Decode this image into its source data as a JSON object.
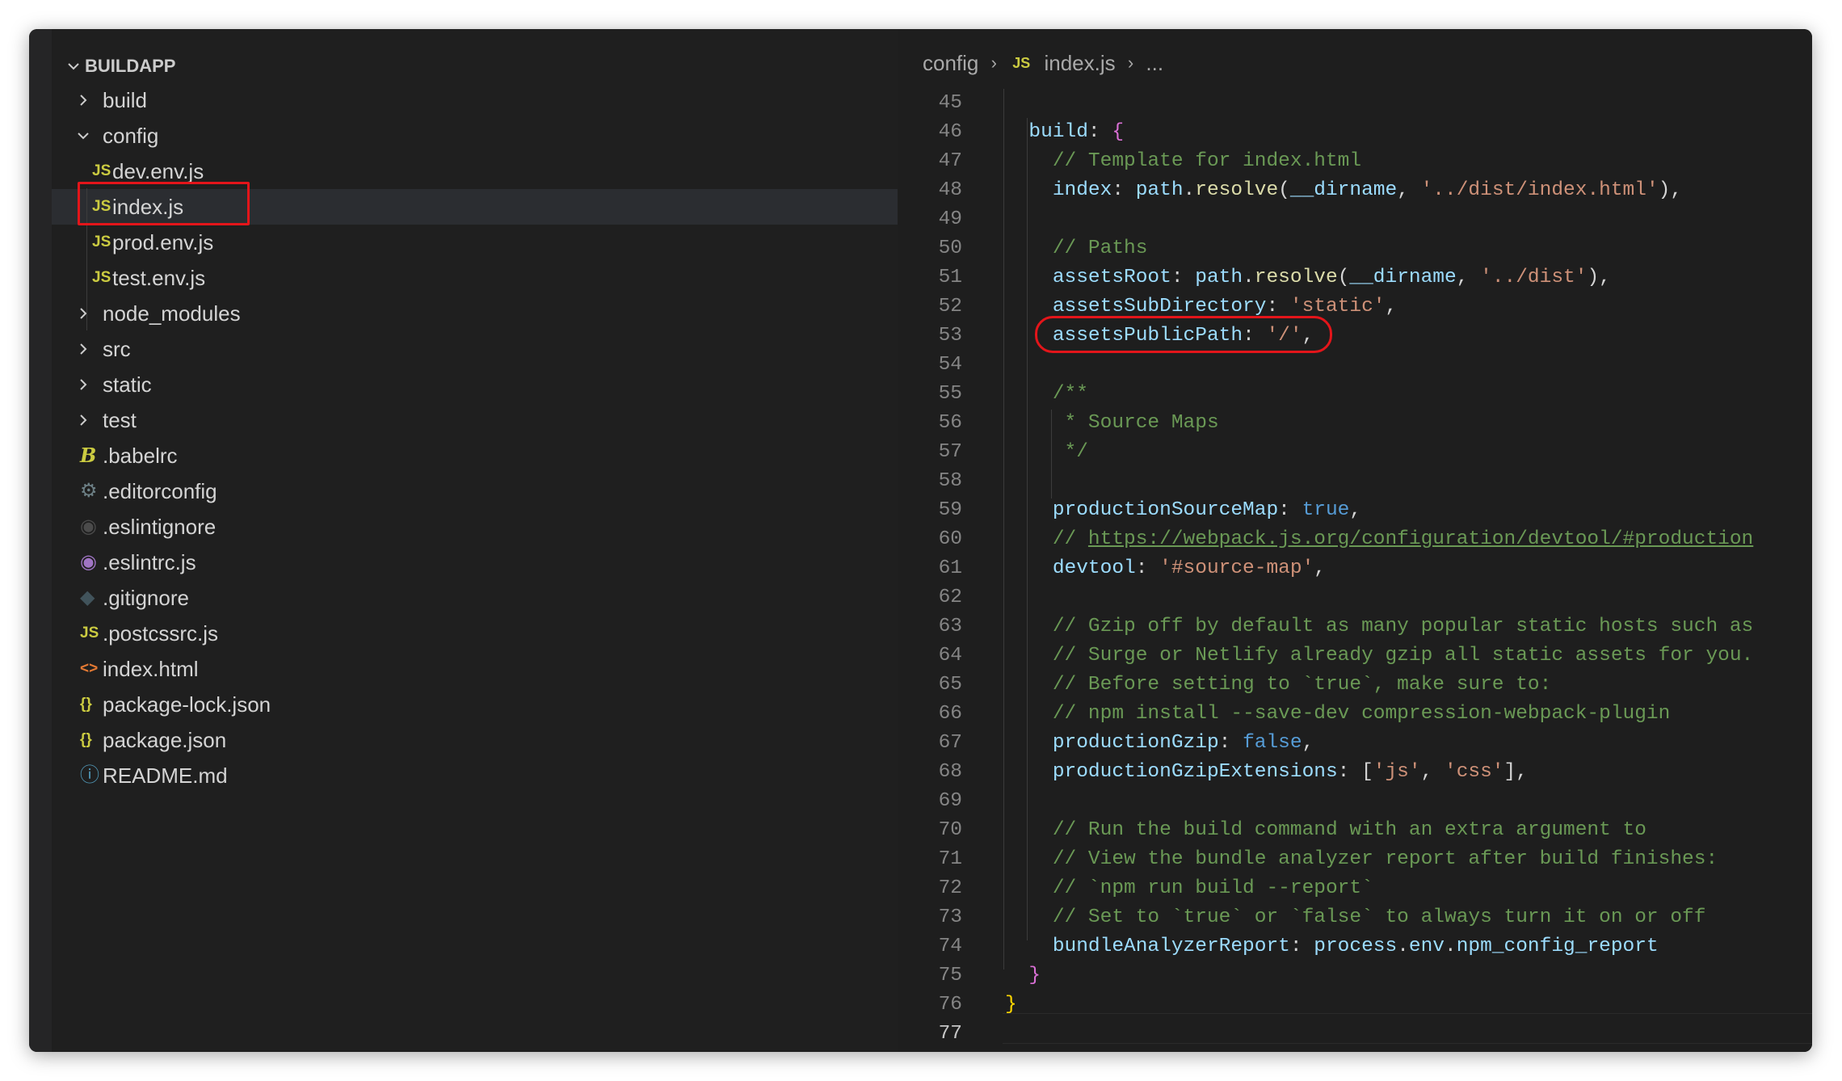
{
  "explorer": {
    "root": "BUILDAPP",
    "items": [
      {
        "label": "build",
        "type": "folder",
        "expanded": false,
        "depth": 1
      },
      {
        "label": "config",
        "type": "folder",
        "expanded": true,
        "depth": 1
      },
      {
        "label": "dev.env.js",
        "type": "js",
        "icon": "JS",
        "depth": 2
      },
      {
        "label": "index.js",
        "type": "js",
        "icon": "JS",
        "depth": 2,
        "selected": true
      },
      {
        "label": "prod.env.js",
        "type": "js",
        "icon": "JS",
        "depth": 2
      },
      {
        "label": "test.env.js",
        "type": "js",
        "icon": "JS",
        "depth": 2
      },
      {
        "label": "node_modules",
        "type": "folder",
        "expanded": false,
        "depth": 1
      },
      {
        "label": "src",
        "type": "folder",
        "expanded": false,
        "depth": 1
      },
      {
        "label": "static",
        "type": "folder",
        "expanded": false,
        "depth": 1
      },
      {
        "label": "test",
        "type": "folder",
        "expanded": false,
        "depth": 1
      },
      {
        "label": ".babelrc",
        "type": "babel",
        "icon": "B",
        "depth": 1
      },
      {
        "label": ".editorconfig",
        "type": "gear",
        "icon": "⚙",
        "depth": 1
      },
      {
        "label": ".eslintignore",
        "type": "eslintignore",
        "icon": "◉",
        "depth": 1
      },
      {
        "label": ".eslintrc.js",
        "type": "eslint",
        "icon": "◉",
        "depth": 1
      },
      {
        "label": ".gitignore",
        "type": "git",
        "icon": "◆",
        "depth": 1
      },
      {
        "label": ".postcssrc.js",
        "type": "js",
        "icon": "JS",
        "depth": 1
      },
      {
        "label": "index.html",
        "type": "html",
        "icon": "<>",
        "depth": 1
      },
      {
        "label": "package-lock.json",
        "type": "json",
        "icon": "{}",
        "depth": 1
      },
      {
        "label": "package.json",
        "type": "json",
        "icon": "{}",
        "depth": 1
      },
      {
        "label": "README.md",
        "type": "info",
        "icon": "ⓘ",
        "depth": 1
      }
    ]
  },
  "breadcrumb": {
    "folder": "config",
    "file_icon": "JS",
    "file": "index.js",
    "more": "..."
  },
  "editor": {
    "active_line": "77",
    "lines": [
      {
        "n": "45",
        "t": []
      },
      {
        "n": "46",
        "t": [
          [
            "  ",
            ""
          ],
          [
            "build",
            "t-prop"
          ],
          [
            ": ",
            ""
          ],
          [
            "{",
            "t-brace1"
          ]
        ]
      },
      {
        "n": "47",
        "t": [
          [
            "    ",
            ""
          ],
          [
            "// Template for index.html",
            "t-com"
          ]
        ]
      },
      {
        "n": "48",
        "t": [
          [
            "    ",
            ""
          ],
          [
            "index",
            "t-prop"
          ],
          [
            ": ",
            ""
          ],
          [
            "path",
            "t-ident"
          ],
          [
            ".",
            ""
          ],
          [
            "resolve",
            "t-fn"
          ],
          [
            "(",
            ""
          ],
          [
            "__dirname",
            "t-ident"
          ],
          [
            ", ",
            ""
          ],
          [
            "'../dist/index.html'",
            "t-str"
          ],
          [
            "),",
            ""
          ]
        ]
      },
      {
        "n": "49",
        "t": []
      },
      {
        "n": "50",
        "t": [
          [
            "    ",
            ""
          ],
          [
            "// Paths",
            "t-com"
          ]
        ]
      },
      {
        "n": "51",
        "t": [
          [
            "    ",
            ""
          ],
          [
            "assetsRoot",
            "t-prop"
          ],
          [
            ": ",
            ""
          ],
          [
            "path",
            "t-ident"
          ],
          [
            ".",
            ""
          ],
          [
            "resolve",
            "t-fn"
          ],
          [
            "(",
            ""
          ],
          [
            "__dirname",
            "t-ident"
          ],
          [
            ", ",
            ""
          ],
          [
            "'../dist'",
            "t-str"
          ],
          [
            "),",
            ""
          ]
        ]
      },
      {
        "n": "52",
        "t": [
          [
            "    ",
            ""
          ],
          [
            "assetsSubDirectory",
            "t-prop"
          ],
          [
            ": ",
            ""
          ],
          [
            "'static'",
            "t-str"
          ],
          [
            ",",
            ""
          ]
        ]
      },
      {
        "n": "53",
        "t": [
          [
            "    ",
            ""
          ],
          [
            "assetsPublicPath",
            "t-prop"
          ],
          [
            ": ",
            ""
          ],
          [
            "'/'",
            "t-str"
          ],
          [
            ",",
            ""
          ]
        ]
      },
      {
        "n": "54",
        "t": []
      },
      {
        "n": "55",
        "t": [
          [
            "    ",
            ""
          ],
          [
            "/**",
            "t-com"
          ]
        ]
      },
      {
        "n": "56",
        "t": [
          [
            "     ",
            ""
          ],
          [
            "* Source Maps",
            "t-com"
          ]
        ]
      },
      {
        "n": "57",
        "t": [
          [
            "     ",
            ""
          ],
          [
            "*/",
            "t-com"
          ]
        ]
      },
      {
        "n": "58",
        "t": []
      },
      {
        "n": "59",
        "t": [
          [
            "    ",
            ""
          ],
          [
            "productionSourceMap",
            "t-prop"
          ],
          [
            ": ",
            ""
          ],
          [
            "true",
            "t-bool"
          ],
          [
            ",",
            ""
          ]
        ]
      },
      {
        "n": "60",
        "t": [
          [
            "    ",
            ""
          ],
          [
            "// ",
            "t-com"
          ],
          [
            "https://webpack.js.org/configuration/devtool/#production",
            "t-link"
          ]
        ]
      },
      {
        "n": "61",
        "t": [
          [
            "    ",
            ""
          ],
          [
            "devtool",
            "t-prop"
          ],
          [
            ": ",
            ""
          ],
          [
            "'#source-map'",
            "t-str"
          ],
          [
            ",",
            ""
          ]
        ]
      },
      {
        "n": "62",
        "t": []
      },
      {
        "n": "63",
        "t": [
          [
            "    ",
            ""
          ],
          [
            "// Gzip off by default as many popular static hosts such as",
            "t-com"
          ]
        ]
      },
      {
        "n": "64",
        "t": [
          [
            "    ",
            ""
          ],
          [
            "// Surge or Netlify already gzip all static assets for you.",
            "t-com"
          ]
        ]
      },
      {
        "n": "65",
        "t": [
          [
            "    ",
            ""
          ],
          [
            "// Before setting to `true`, make sure to:",
            "t-com"
          ]
        ]
      },
      {
        "n": "66",
        "t": [
          [
            "    ",
            ""
          ],
          [
            "// npm install --save-dev compression-webpack-plugin",
            "t-com"
          ]
        ]
      },
      {
        "n": "67",
        "t": [
          [
            "    ",
            ""
          ],
          [
            "productionGzip",
            "t-prop"
          ],
          [
            ": ",
            ""
          ],
          [
            "false",
            "t-bool"
          ],
          [
            ",",
            ""
          ]
        ]
      },
      {
        "n": "68",
        "t": [
          [
            "    ",
            ""
          ],
          [
            "productionGzipExtensions",
            "t-prop"
          ],
          [
            ": [",
            ""
          ],
          [
            "'js'",
            "t-str"
          ],
          [
            ", ",
            ""
          ],
          [
            "'css'",
            "t-str"
          ],
          [
            "],",
            ""
          ]
        ]
      },
      {
        "n": "69",
        "t": []
      },
      {
        "n": "70",
        "t": [
          [
            "    ",
            ""
          ],
          [
            "// Run the build command with an extra argument to",
            "t-com"
          ]
        ]
      },
      {
        "n": "71",
        "t": [
          [
            "    ",
            ""
          ],
          [
            "// View the bundle analyzer report after build finishes:",
            "t-com"
          ]
        ]
      },
      {
        "n": "72",
        "t": [
          [
            "    ",
            ""
          ],
          [
            "// `npm run build --report`",
            "t-com"
          ]
        ]
      },
      {
        "n": "73",
        "t": [
          [
            "    ",
            ""
          ],
          [
            "// Set to `true` or `false` to always turn it on or off",
            "t-com"
          ]
        ]
      },
      {
        "n": "74",
        "t": [
          [
            "    ",
            ""
          ],
          [
            "bundleAnalyzerReport",
            "t-prop"
          ],
          [
            ": ",
            ""
          ],
          [
            "process",
            "t-ident"
          ],
          [
            ".",
            ""
          ],
          [
            "env",
            "t-ident"
          ],
          [
            ".",
            ""
          ],
          [
            "npm_config_report",
            "t-ident"
          ]
        ]
      },
      {
        "n": "75",
        "t": [
          [
            "  ",
            ""
          ],
          [
            "}",
            "t-brace1"
          ]
        ]
      },
      {
        "n": "76",
        "t": [
          [
            "}",
            "t-brace0"
          ]
        ]
      },
      {
        "n": "77",
        "t": []
      }
    ]
  },
  "colors": {
    "annotation": "#e3151a",
    "js_icon": "#cbcb41",
    "babel_icon": "#cbcb41",
    "html_icon": "#e37933",
    "json_icon": "#cbcb41",
    "info_icon": "#519aba",
    "eslint_icon": "#a074c4"
  }
}
